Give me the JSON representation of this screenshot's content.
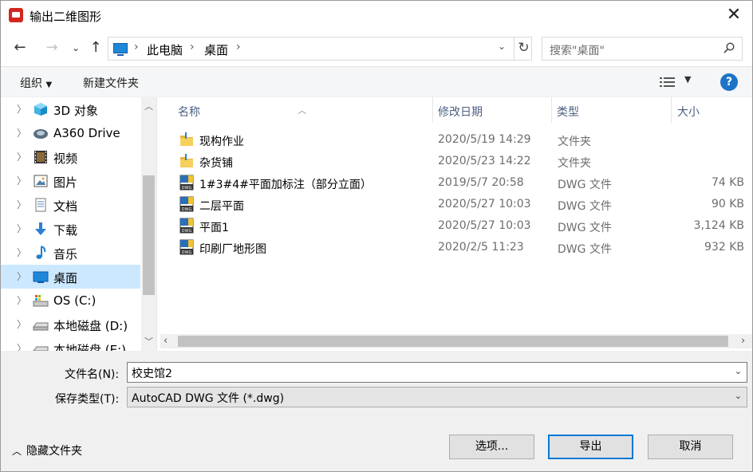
{
  "window": {
    "title": "输出二维图形"
  },
  "nav": {
    "breadcrumb": [
      "此电脑",
      "桌面"
    ],
    "search_placeholder": "搜索\"桌面\""
  },
  "commands": {
    "organize": "组织",
    "new_folder": "新建文件夹"
  },
  "tree": [
    {
      "label": "3D 对象",
      "icon": "3d-objects-icon"
    },
    {
      "label": "A360 Drive",
      "icon": "a360-drive-icon"
    },
    {
      "label": "视频",
      "icon": "video-icon"
    },
    {
      "label": "图片",
      "icon": "pictures-icon"
    },
    {
      "label": "文档",
      "icon": "documents-icon"
    },
    {
      "label": "下载",
      "icon": "download-icon"
    },
    {
      "label": "音乐",
      "icon": "music-icon"
    },
    {
      "label": "桌面",
      "icon": "desktop-icon",
      "selected": true
    },
    {
      "label": "OS (C:)",
      "icon": "drive-c-icon"
    },
    {
      "label": "本地磁盘 (D:)",
      "icon": "drive-d-icon"
    },
    {
      "label": "本地磁盘 (E:)",
      "icon": "drive-e-icon"
    }
  ],
  "columns": {
    "name": "名称",
    "modified": "修改日期",
    "type": "类型",
    "size": "大小"
  },
  "files": [
    {
      "name": "现构作业",
      "date": "2020/5/19 14:29",
      "type": "文件夹",
      "size": "",
      "icon": "folder-icon"
    },
    {
      "name": "杂货铺",
      "date": "2020/5/23 14:22",
      "type": "文件夹",
      "size": "",
      "icon": "folder-icon"
    },
    {
      "name": "1#3#4#平面加标注（部分立面）",
      "date": "2019/5/7 20:58",
      "type": "DWG 文件",
      "size": "74 KB",
      "icon": "dwg-file-icon"
    },
    {
      "name": "二层平面",
      "date": "2020/5/27 10:03",
      "type": "DWG 文件",
      "size": "90 KB",
      "icon": "dwg-file-icon"
    },
    {
      "name": "平面1",
      "date": "2020/5/27 10:03",
      "type": "DWG 文件",
      "size": "3,124 KB",
      "icon": "dwg-file-icon"
    },
    {
      "name": "印刷厂地形图",
      "date": "2020/2/5 11:23",
      "type": "DWG 文件",
      "size": "932 KB",
      "icon": "dwg-file-icon"
    }
  ],
  "form": {
    "filename_label": "文件名(N):",
    "filename_value": "校史馆2",
    "filetype_label": "保存类型(T):",
    "filetype_value": "AutoCAD DWG 文件 (*.dwg)"
  },
  "footer": {
    "hide_folders": "隐藏文件夹",
    "options": "选项...",
    "export": "导出",
    "cancel": "取消"
  },
  "colors": {
    "accent": "#0078d7",
    "selected_bg": "#cce8ff",
    "help": "#1d73c7"
  }
}
